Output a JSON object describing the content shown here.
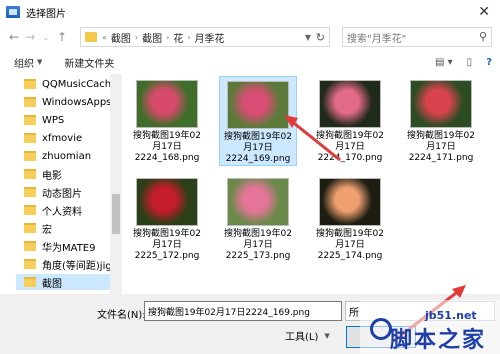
{
  "window": {
    "title": "选择图片"
  },
  "nav": {
    "breadcrumb": [
      "截图",
      "截图",
      "花",
      "月季花"
    ],
    "search_placeholder": "搜索\"月季花\""
  },
  "toolbar": {
    "organize": "组织",
    "new_folder": "新建文件夹"
  },
  "sidebar": {
    "items": [
      {
        "label": "QQMusicCache",
        "selected": false
      },
      {
        "label": "WindowsApps",
        "selected": false
      },
      {
        "label": "WPS",
        "selected": false
      },
      {
        "label": "xfmovie",
        "selected": false
      },
      {
        "label": "zhuomian",
        "selected": false
      },
      {
        "label": "电影",
        "selected": false
      },
      {
        "label": "动态图片",
        "selected": false
      },
      {
        "label": "个人资料",
        "selected": false
      },
      {
        "label": "宏",
        "selected": false
      },
      {
        "label": "华为MATE9",
        "selected": false
      },
      {
        "label": "角度(等间距)jig",
        "selected": false
      },
      {
        "label": "截图",
        "selected": true
      }
    ]
  },
  "files": [
    {
      "name": "搜狗截图19年02\n月17日\n2224_168.png",
      "selected": false,
      "colors": [
        "#d84a6a",
        "#3f6e2a"
      ]
    },
    {
      "name": "搜狗截图19年02\n月17日\n2224_169.png",
      "selected": true,
      "colors": [
        "#d84d73",
        "#5b7a3a"
      ]
    },
    {
      "name": "搜狗截图19年02\n月17日\n2224_170.png",
      "selected": false,
      "colors": [
        "#e36a89",
        "#1f2a1a"
      ]
    },
    {
      "name": "搜狗截图19年02\n月17日\n2224_171.png",
      "selected": false,
      "colors": [
        "#d9434e",
        "#2c4d23"
      ]
    },
    {
      "name": "搜狗截图19年02\n月17日\n2225_172.png",
      "selected": false,
      "colors": [
        "#c51c2a",
        "#2b3f18"
      ]
    },
    {
      "name": "搜狗截图19年02\n月17日\n2225_173.png",
      "selected": false,
      "colors": [
        "#e57598",
        "#6b8a4a"
      ]
    },
    {
      "name": "搜狗截图19年02\n月17日\n2225_174.png",
      "selected": false,
      "colors": [
        "#f0a070",
        "#1d1d12"
      ]
    }
  ],
  "bottom": {
    "filename_label": "文件名(N):",
    "filename_value": "搜狗截图19年02月17日2224_169.png",
    "filetype_value": "所",
    "tools_label": "工具(L)"
  },
  "watermark": {
    "url": "jb51.net",
    "text": "脚本之家"
  },
  "colors": {
    "accent": "#0078d7",
    "selection": "#cce8ff",
    "folder": "#f5cf5a",
    "arrow": "#e03a3a",
    "watermark": "#1e3fa8"
  }
}
